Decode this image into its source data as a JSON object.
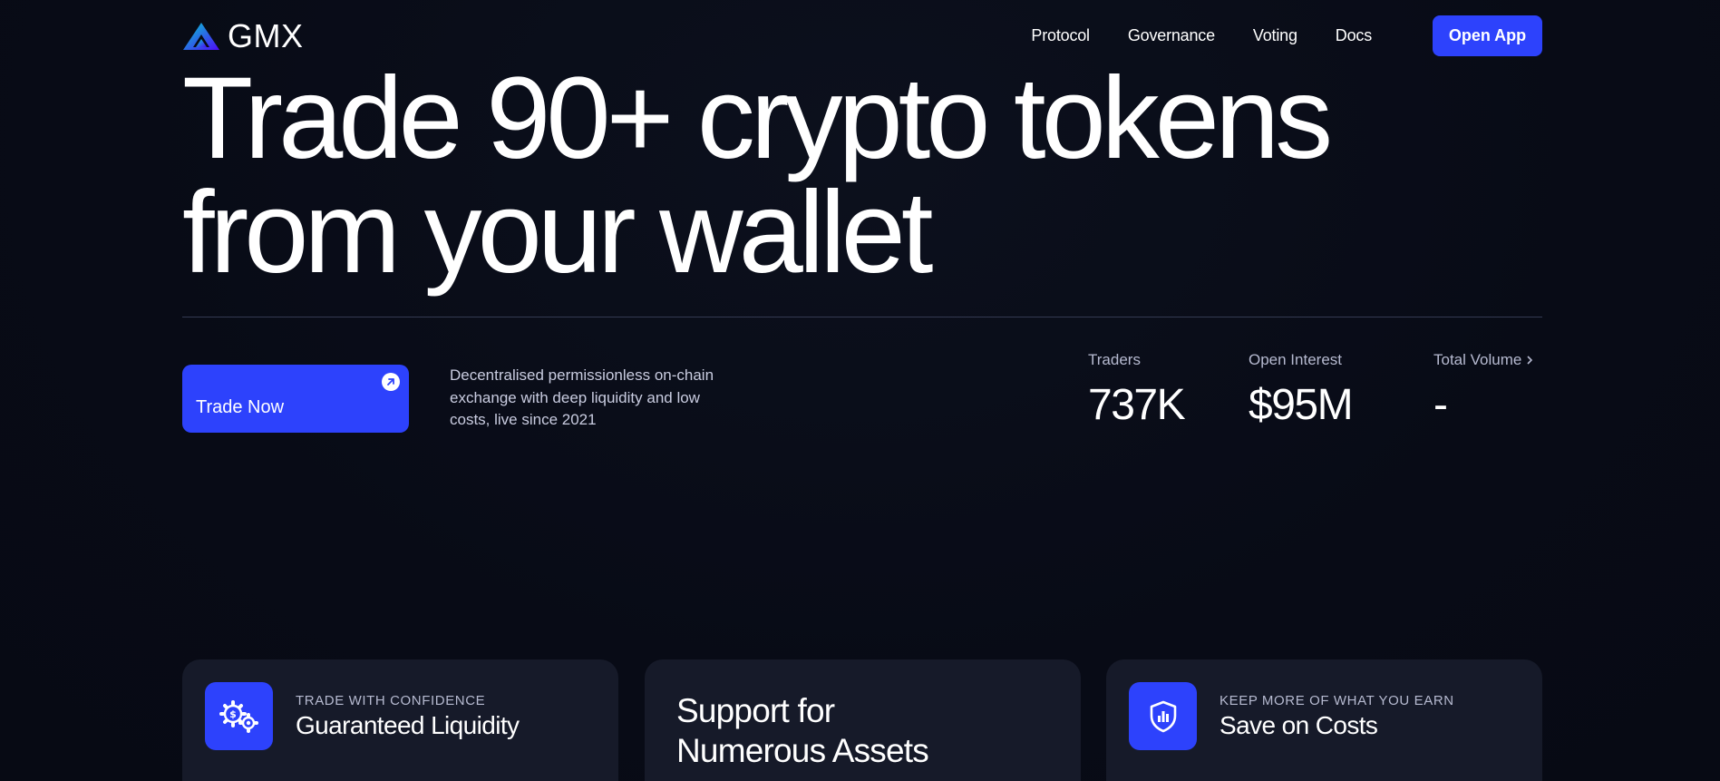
{
  "header": {
    "brand": "GMX",
    "nav": [
      "Protocol",
      "Governance",
      "Voting",
      "Docs"
    ],
    "cta": "Open App"
  },
  "hero": {
    "title_line1": "Trade 90+ crypto tokens",
    "title_line2": "from your wallet",
    "trade_button": "Trade Now",
    "description": "Decentralised permissionless on-chain exchange with deep liquidity and low costs, live since 2021"
  },
  "stats": [
    {
      "label": "Traders",
      "value": "737K"
    },
    {
      "label": "Open Interest",
      "value": "$95M"
    },
    {
      "label": "Total Volume",
      "value": "-"
    }
  ],
  "cards": [
    {
      "kicker": "TRADE WITH CONFIDENCE",
      "title": "Guaranteed Liquidity",
      "icon": "gears-dollar-icon"
    },
    {
      "title_line1": "Support for",
      "title_line2": "Numerous Assets"
    },
    {
      "kicker": "KEEP MORE OF WHAT YOU EARN",
      "title": "Save on Costs",
      "icon": "shield-chart-icon"
    }
  ],
  "colors": {
    "background": "#080b16",
    "accent": "#2d42fc",
    "card": "#161a29"
  }
}
